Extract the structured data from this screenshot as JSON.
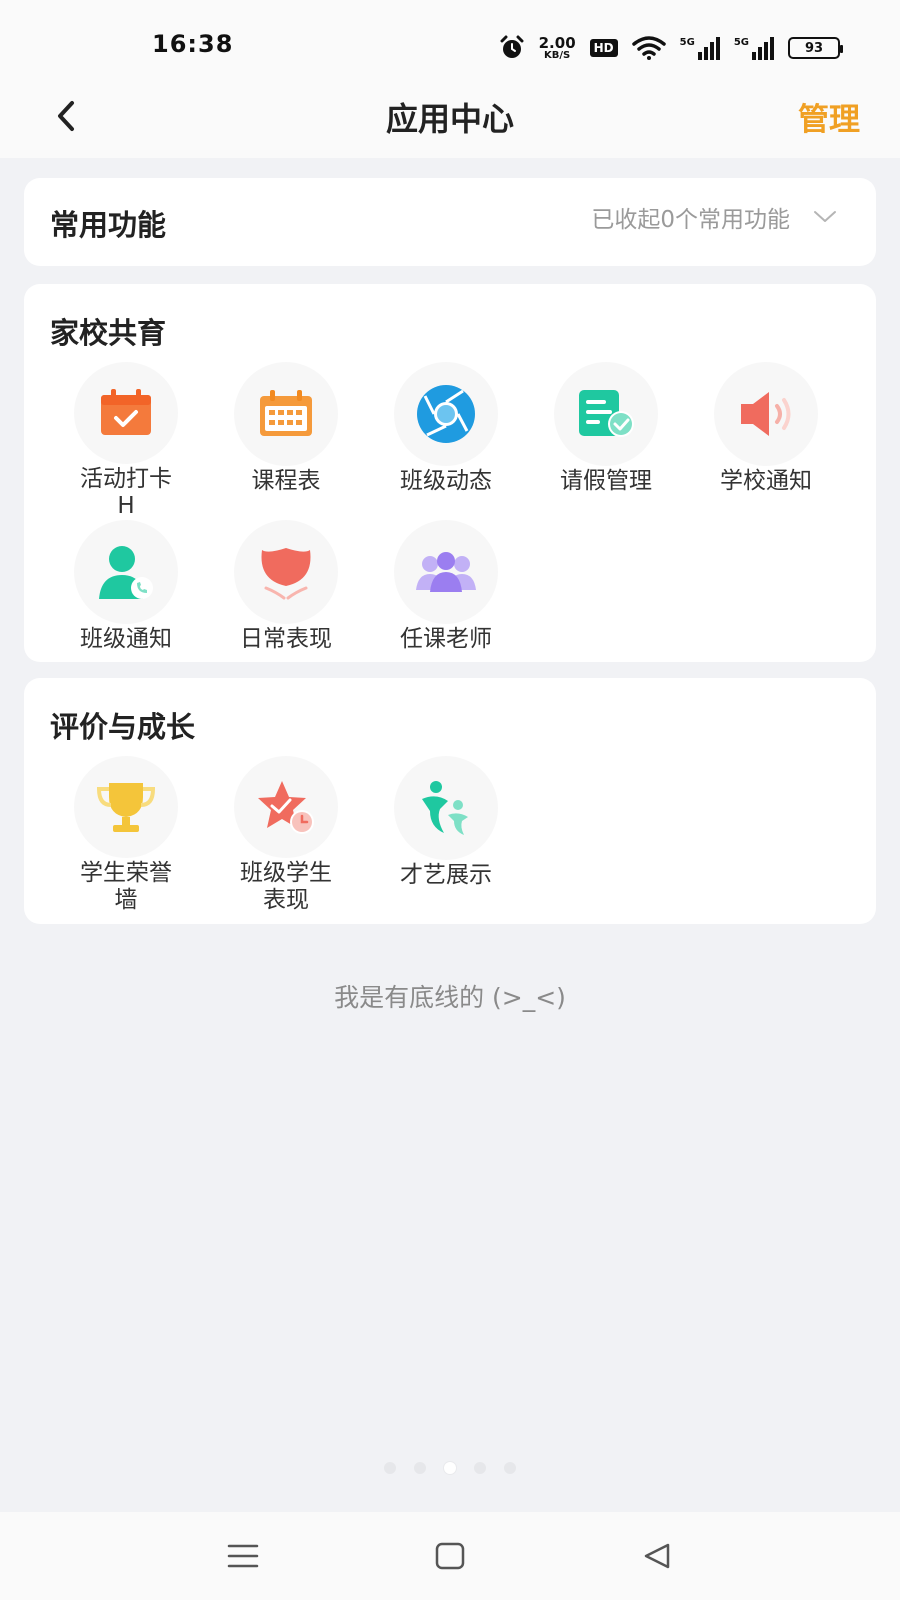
{
  "status_bar": {
    "time": "16:38",
    "net_speed_value": "2.00",
    "net_speed_unit": "KB/S",
    "hd_badge": "HD",
    "signal1_label": "5G",
    "signal2_label": "5G",
    "battery_level": "93"
  },
  "header": {
    "title": "应用中心",
    "manage_label": "管理",
    "accent_color": "#f0a024"
  },
  "common_functions": {
    "title": "常用功能",
    "status_text": "已收起0个常用功能"
  },
  "home_school": {
    "title": "家校共育",
    "apps": [
      {
        "label": "活动打卡\nH",
        "icon": "checkin-calendar-icon",
        "color": "#f47a3c"
      },
      {
        "label": "课程表",
        "icon": "timetable-calendar-icon",
        "color": "#f59a3b"
      },
      {
        "label": "班级动态",
        "icon": "camera-shutter-icon",
        "color": "#1f9be0"
      },
      {
        "label": "请假管理",
        "icon": "leave-document-icon",
        "color": "#1fc8a0"
      },
      {
        "label": "学校通知",
        "icon": "speaker-icon",
        "color": "#f06b5e"
      },
      {
        "label": "班级通知",
        "icon": "contact-phone-icon",
        "color": "#1fc8a0"
      },
      {
        "label": "日常表现",
        "icon": "lotus-icon",
        "color": "#f06b5e"
      },
      {
        "label": "任课老师",
        "icon": "teachers-group-icon",
        "color": "#9b7ef0"
      }
    ]
  },
  "evaluation_growth": {
    "title": "评价与成长",
    "apps": [
      {
        "label": "学生荣誉\n墙",
        "icon": "trophy-icon",
        "color": "#f4c53a"
      },
      {
        "label": "班级学生\n表现",
        "icon": "star-clock-icon",
        "color": "#f06b5e"
      },
      {
        "label": "才艺展示",
        "icon": "talent-figures-icon",
        "color": "#1fc8a0"
      }
    ]
  },
  "footer_note": "我是有底线的 (>_<)",
  "pagination": {
    "total": 5,
    "active": 3
  }
}
